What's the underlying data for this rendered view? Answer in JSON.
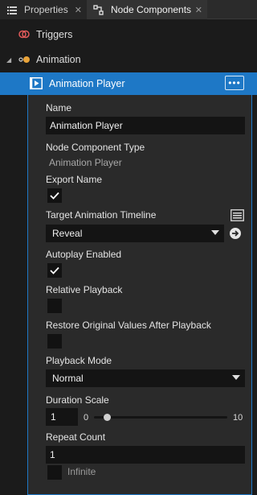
{
  "tabs": [
    {
      "label": "Properties",
      "icon": "list-icon",
      "close": "✕"
    },
    {
      "label": "Node Components",
      "icon": "node-components-icon",
      "close": "✕"
    }
  ],
  "tree": {
    "triggers": {
      "label": "Triggers",
      "icon": "triggers-icon"
    },
    "animation": {
      "label": "Animation",
      "icon": "animation-icon",
      "expanded": true
    },
    "player": {
      "label": "Animation Player",
      "icon": "animation-player-icon",
      "more": "•••",
      "selected": true
    }
  },
  "panel": {
    "name_label": "Name",
    "name_value": "Animation Player",
    "type_label": "Node Component Type",
    "type_value": "Animation Player",
    "export_label": "Export Name",
    "export_checked": true,
    "timeline_label": "Target Animation Timeline",
    "timeline_value": "Reveal",
    "autoplay_label": "Autoplay Enabled",
    "autoplay_checked": true,
    "relative_label": "Relative Playback",
    "relative_checked": false,
    "restore_label": "Restore Original Values After Playback",
    "restore_checked": false,
    "mode_label": "Playback Mode",
    "mode_value": "Normal",
    "duration_label": "Duration Scale",
    "duration_value": "1",
    "duration_min": "0",
    "duration_max": "10",
    "duration_level": 0.1,
    "repeat_label": "Repeat Count",
    "repeat_value": "1",
    "infinite_label": "Infinite",
    "infinite_checked": false
  },
  "colors": {
    "accent": "#1e78c6",
    "background": "#1b1b1b",
    "panel": "#2a2a2a",
    "field": "#141414"
  }
}
